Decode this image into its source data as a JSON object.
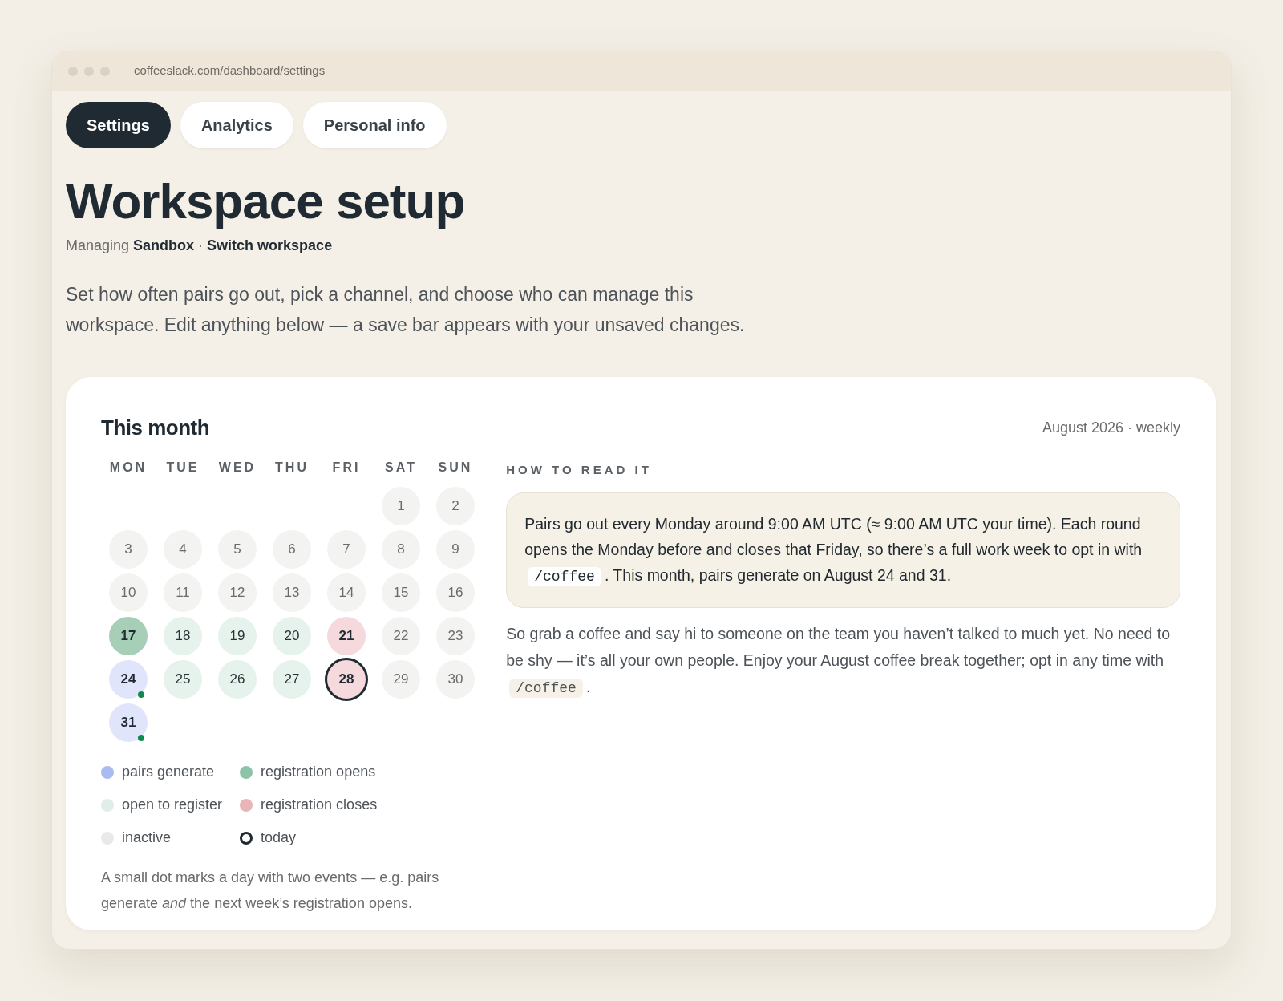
{
  "window": {
    "address": "coffeeslack.com/dashboard/settings"
  },
  "tabs": [
    {
      "label": "Settings",
      "selected": true
    },
    {
      "label": "Analytics",
      "selected": false
    },
    {
      "label": "Personal info",
      "selected": false
    }
  ],
  "heading": "Workspace setup",
  "subtitle": {
    "text": "Managing **Sandbox** ·",
    "link": "Switch workspace"
  },
  "intro": "Set how often pairs go out, pick a channel, and choose who can manage this workspace. Edit anything below — a save bar appears with your unsaved changes.",
  "card": {
    "title": "This month",
    "meta": "August 2026 · weekly",
    "weekdays": [
      "MON",
      "TUE",
      "WED",
      "THU",
      "FRI",
      "SAT",
      "SUN"
    ],
    "days": [
      {
        "kind": "blank"
      },
      {
        "kind": "blank"
      },
      {
        "kind": "blank"
      },
      {
        "kind": "blank"
      },
      {
        "kind": "blank"
      },
      {
        "label": "1",
        "kind": "inactive",
        "today": false,
        "second_event": false
      },
      {
        "label": "2",
        "kind": "inactive",
        "today": false,
        "second_event": false
      },
      {
        "label": "3",
        "kind": "inactive",
        "today": false,
        "second_event": false
      },
      {
        "label": "4",
        "kind": "inactive",
        "today": false,
        "second_event": false
      },
      {
        "label": "5",
        "kind": "inactive",
        "today": false,
        "second_event": false
      },
      {
        "label": "6",
        "kind": "inactive",
        "today": false,
        "second_event": false
      },
      {
        "label": "7",
        "kind": "inactive",
        "today": false,
        "second_event": false
      },
      {
        "label": "8",
        "kind": "inactive",
        "today": false,
        "second_event": false
      },
      {
        "label": "9",
        "kind": "inactive",
        "today": false,
        "second_event": false
      },
      {
        "label": "10",
        "kind": "inactive",
        "today": false,
        "second_event": false
      },
      {
        "label": "11",
        "kind": "inactive",
        "today": false,
        "second_event": false
      },
      {
        "label": "12",
        "kind": "inactive",
        "today": false,
        "second_event": false
      },
      {
        "label": "13",
        "kind": "inactive",
        "today": false,
        "second_event": false
      },
      {
        "label": "14",
        "kind": "inactive",
        "today": false,
        "second_event": false
      },
      {
        "label": "15",
        "kind": "inactive",
        "today": false,
        "second_event": false
      },
      {
        "label": "16",
        "kind": "inactive",
        "today": false,
        "second_event": false
      },
      {
        "label": "17",
        "kind": "opens",
        "today": false,
        "second_event": false
      },
      {
        "label": "18",
        "kind": "open",
        "today": false,
        "second_event": false
      },
      {
        "label": "19",
        "kind": "open",
        "today": false,
        "second_event": false
      },
      {
        "label": "20",
        "kind": "open",
        "today": false,
        "second_event": false
      },
      {
        "label": "21",
        "kind": "closes",
        "today": false,
        "second_event": false
      },
      {
        "label": "22",
        "kind": "inactive",
        "today": false,
        "second_event": false
      },
      {
        "label": "23",
        "kind": "inactive",
        "today": false,
        "second_event": false
      },
      {
        "label": "24",
        "kind": "pairs",
        "today": false,
        "second_event": true
      },
      {
        "label": "25",
        "kind": "open",
        "today": false,
        "second_event": false
      },
      {
        "label": "26",
        "kind": "open",
        "today": false,
        "second_event": false
      },
      {
        "label": "27",
        "kind": "open",
        "today": false,
        "second_event": false
      },
      {
        "label": "28",
        "kind": "closes",
        "today": true,
        "second_event": false
      },
      {
        "label": "29",
        "kind": "inactive",
        "today": false,
        "second_event": false
      },
      {
        "label": "30",
        "kind": "inactive",
        "today": false,
        "second_event": false
      },
      {
        "label": "31",
        "kind": "pairs",
        "today": false,
        "second_event": true
      }
    ],
    "legend": [
      {
        "label": "pairs generate",
        "kind": "pairs"
      },
      {
        "label": "registration opens",
        "kind": "opens"
      },
      {
        "label": "open to register",
        "kind": "open"
      },
      {
        "label": "registration closes",
        "kind": "closes"
      },
      {
        "label": "inactive",
        "kind": "inactive"
      },
      {
        "label": "today",
        "kind": "today"
      }
    ],
    "footnote": "A small dot marks a day with two events — e.g. pairs generate *and* the next week’s registration opens.",
    "help_heading": "HOW TO READ IT",
    "help_box": [
      {
        "kind": "text",
        "text": "Pairs go out every Monday around 9:00 AM UTC (≈ 9:00 AM UTC your time). Each round opens the Monday before and closes that Friday, so there’s a full work week to opt in with "
      },
      {
        "kind": "code",
        "text": "/coffee"
      },
      {
        "kind": "text",
        "text": ". This month, pairs generate on August 24 and 31."
      }
    ],
    "help_text": [
      {
        "kind": "text",
        "text": "So grab a coffee and say hi to someone on the team you haven’t talked to much yet. No need to be shy — it’s all your own people. Enjoy your August coffee break together; opt in any time with "
      },
      {
        "kind": "code",
        "text": "/coffee"
      },
      {
        "kind": "text",
        "text": "."
      }
    ]
  }
}
